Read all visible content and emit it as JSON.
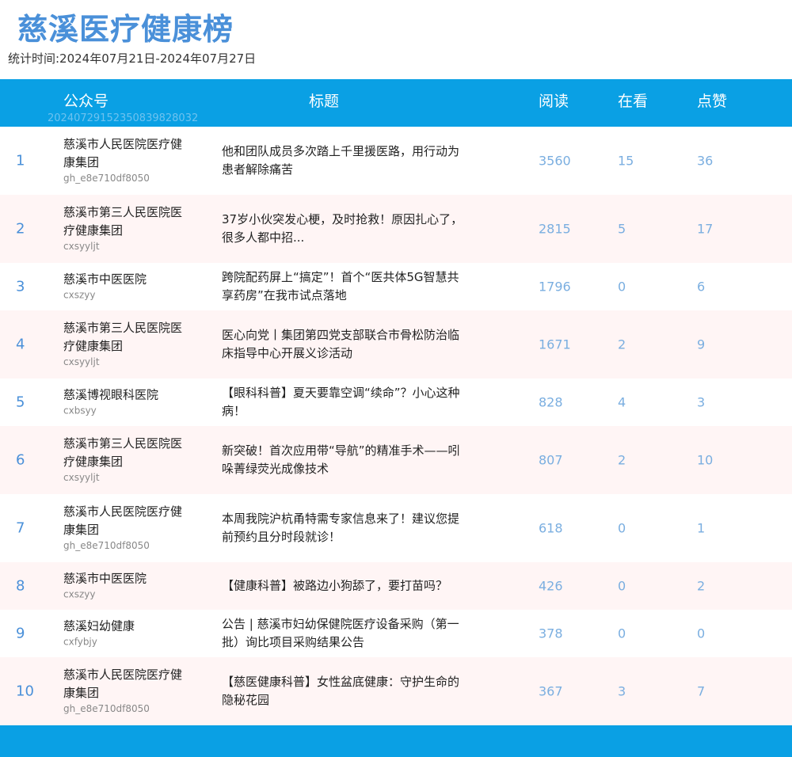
{
  "title": "慈溪医疗健康榜",
  "subtitle": "统计时间:2024年07月21日-2024年07月27日",
  "header": {
    "col_account": "公众号",
    "col_title": "标题",
    "col_read": "阅读",
    "col_watch": "在看",
    "col_like": "点赞",
    "code": "20240729152350839828032"
  },
  "rows": [
    {
      "rank": "1",
      "account": "慈溪市人民医院医疗健康集团",
      "account_id": "gh_e8e710df8050",
      "title": "他和团队成员多次踏上千里援医路，用行动为患者解除痛苦",
      "read": "3560",
      "watch": "15",
      "like": "36"
    },
    {
      "rank": "2",
      "account": "慈溪市第三人民医院医疗健康集团",
      "account_id": "cxsyyljt",
      "title": "37岁小伙突发心梗，及时抢救！原因扎心了，很多人都中招...",
      "read": "2815",
      "watch": "5",
      "like": "17"
    },
    {
      "rank": "3",
      "account": "慈溪市中医医院",
      "account_id": "cxszyy",
      "title": "跨院配药屏上“搞定”！首个“医共体5G智慧共享药房”在我市试点落地",
      "read": "1796",
      "watch": "0",
      "like": "6"
    },
    {
      "rank": "4",
      "account": "慈溪市第三人民医院医疗健康集团",
      "account_id": "cxsyyljt",
      "title": "医心向党丨集团第四党支部联合市骨松防治临床指导中心开展义诊活动",
      "read": "1671",
      "watch": "2",
      "like": "9"
    },
    {
      "rank": "5",
      "account": "慈溪博视眼科医院",
      "account_id": "cxbsyy",
      "title": "【眼科科普】夏天要靠空调“续命”？小心这种病！",
      "read": "828",
      "watch": "4",
      "like": "3"
    },
    {
      "rank": "6",
      "account": "慈溪市第三人民医院医疗健康集团",
      "account_id": "cxsyyljt",
      "title": "新突破！首次应用带“导航”的精准手术——吲哚菁绿荧光成像技术",
      "read": "807",
      "watch": "2",
      "like": "10"
    },
    {
      "rank": "7",
      "account": "慈溪市人民医院医疗健康集团",
      "account_id": "gh_e8e710df8050",
      "title": "本周我院沪杭甬特需专家信息来了！建议您提前预约且分时段就诊！",
      "read": "618",
      "watch": "0",
      "like": "1"
    },
    {
      "rank": "8",
      "account": "慈溪市中医医院",
      "account_id": "cxszyy",
      "title": "【健康科普】被路边小狗舔了，要打苗吗？",
      "read": "426",
      "watch": "0",
      "like": "2"
    },
    {
      "rank": "9",
      "account": "慈溪妇幼健康",
      "account_id": "cxfybjy",
      "title": "公告 | 慈溪市妇幼保健院医疗设备采购（第一批）询比项目采购结果公告",
      "read": "378",
      "watch": "0",
      "like": "0"
    },
    {
      "rank": "10",
      "account": "慈溪市人民医院医疗健康集团",
      "account_id": "gh_e8e710df8050",
      "title": "【慈医健康科普】女性盆底健康：守护生命的隐秘花园",
      "read": "367",
      "watch": "3",
      "like": "7"
    }
  ]
}
